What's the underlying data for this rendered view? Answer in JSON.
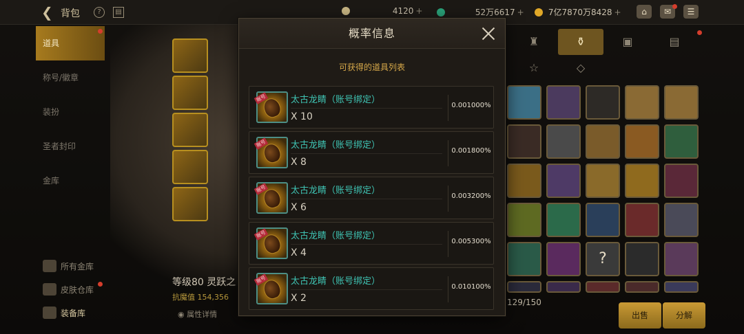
{
  "topbar": {
    "back_icon": "back-arrow-icon",
    "title": "背包",
    "currencies": [
      {
        "icon": "moon-coin-icon",
        "value": "4120",
        "color": "#c9b784"
      },
      {
        "icon": "jade-coin-icon",
        "value": "52万6617",
        "color": "#2aa37a"
      },
      {
        "icon": "gold-coin-icon",
        "value": "7亿7870万8428",
        "color": "#e0a828"
      }
    ]
  },
  "left_nav": {
    "items": [
      "道具",
      "称号/徽章",
      "装扮",
      "圣者封印",
      "金库"
    ],
    "bottom": [
      "所有金库",
      "皮肤仓库",
      "装备库"
    ]
  },
  "character": {
    "level_name": "等级80 灵跃之",
    "power_label": "抗魔值 154,356"
  },
  "bag": {
    "capacity": "129/150",
    "sell_label": "出售",
    "decompose_label": "分解",
    "attr_details": "属性详情"
  },
  "modal": {
    "title": "概率信息",
    "subtitle": "可获得的道具列表",
    "items": [
      {
        "name": "太古龙睛（账号绑定）",
        "qty": "X 10",
        "prob": "0.001000%"
      },
      {
        "name": "太古龙睛（账号绑定）",
        "qty": "X 8",
        "prob": "0.001800%"
      },
      {
        "name": "太古龙睛（账号绑定）",
        "qty": "X 6",
        "prob": "0.003200%"
      },
      {
        "name": "太古龙睛（账号绑定）",
        "qty": "X 4",
        "prob": "0.005300%"
      },
      {
        "name": "太古龙睛（账号绑定）",
        "qty": "X 2",
        "prob": "0.010100%"
      }
    ],
    "item_icon": "dragon-eye-seed-icon",
    "bound_tag": "账号"
  },
  "colors": {
    "accent_gold": "#b8901f",
    "item_name_teal": "#3fc3b3",
    "subtitle_gold": "#d7a94a"
  }
}
